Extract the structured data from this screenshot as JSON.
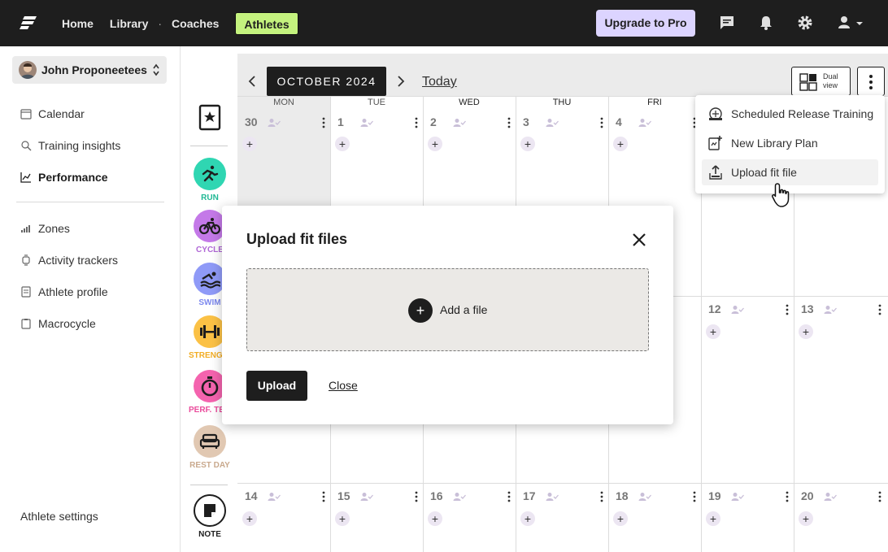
{
  "topbar": {
    "nav": [
      {
        "label": "Home"
      },
      {
        "label": "Library"
      },
      {
        "label": "Coaches"
      },
      {
        "label": "Athletes"
      }
    ],
    "upgrade_label": "Upgrade to Pro",
    "icons": [
      "chat-icon",
      "bell-icon",
      "gear-icon",
      "user-icon"
    ]
  },
  "sidebar": {
    "athlete_name": "John Proponeetees",
    "items": [
      {
        "label": "Calendar",
        "icon": "calendar-icon"
      },
      {
        "label": "Training insights",
        "icon": "insights-icon"
      },
      {
        "label": "Performance",
        "icon": "chart-icon"
      },
      {
        "label": "Zones",
        "icon": "zones-icon"
      },
      {
        "label": "Activity trackers",
        "icon": "tracker-icon"
      },
      {
        "label": "Athlete profile",
        "icon": "profile-icon"
      },
      {
        "label": "Macrocycle",
        "icon": "clipboard-icon"
      }
    ],
    "settings_label": "Athlete settings"
  },
  "palette": {
    "items": [
      {
        "label": "RUN",
        "color": "#2fd6b2",
        "label_color": "#1fb894"
      },
      {
        "label": "CYCLE",
        "color": "#c479e8",
        "label_color": "#b067d6"
      },
      {
        "label": "SWIM",
        "color": "#8f9af7",
        "label_color": "#7c88ee"
      },
      {
        "label": "STRENGTH",
        "color": "#fbc145",
        "label_color": "#f2ad24"
      },
      {
        "label": "PERF. TEST",
        "color": "#f463ae",
        "label_color": "#ea4c9c"
      },
      {
        "label": "REST DAY",
        "color": "#e1c8b2",
        "label_color": "#c9a98d"
      },
      {
        "label": "NOTE",
        "color": "#ffffff",
        "label_color": "#1e1e1e"
      }
    ]
  },
  "calendar": {
    "month_label": "OCTOBER 2024",
    "today_label": "Today",
    "dual_view_label_1": "Dual",
    "dual_view_label_2": "view",
    "day_names": [
      "MON",
      "TUE",
      "WED",
      "THU",
      "FRI"
    ],
    "week1": [
      "30",
      "1",
      "2",
      "3",
      "4"
    ],
    "week2": [
      "12",
      "13"
    ],
    "week3": [
      "14",
      "15",
      "16",
      "17",
      "18",
      "19",
      "20"
    ],
    "add_symbol": "+"
  },
  "dropdown_menu": {
    "items": [
      {
        "label": "Scheduled Release Training",
        "icon": "release-training-icon"
      },
      {
        "label": "New Library Plan",
        "icon": "library-plan-icon"
      },
      {
        "label": "Upload fit file",
        "icon": "upload-icon"
      }
    ]
  },
  "modal": {
    "title": "Upload fit files",
    "add_file_label": "Add a file",
    "upload_label": "Upload",
    "close_label": "Close"
  }
}
